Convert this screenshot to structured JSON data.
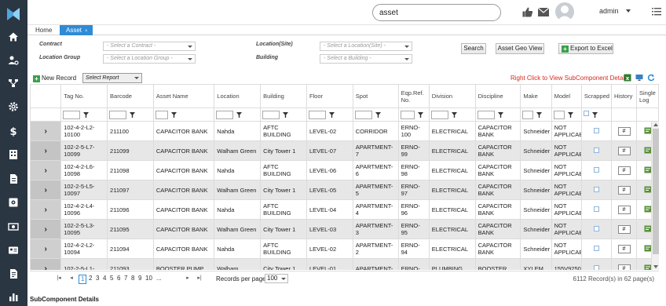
{
  "search": {
    "value": "asset"
  },
  "user": {
    "name": "admin"
  },
  "tabs": [
    {
      "label": "Home"
    },
    {
      "label": "Asset",
      "close": "×"
    }
  ],
  "filters": {
    "contract_label": "Contract",
    "contract_placeholder": "- Select a Contract -",
    "location_group_label": "Location Group",
    "location_group_placeholder": "- Select a Location Group -",
    "location_site_label": "Location(Site)",
    "location_site_placeholder": "- Select a Location(Site) -",
    "building_label": "Building",
    "building_placeholder": "- Select a Building -"
  },
  "actions": {
    "search": "Search",
    "geo_view": "Asset Geo View",
    "export": "Export to Excel"
  },
  "toolbar": {
    "new_record": "New Record",
    "report_placeholder": "Select Report",
    "hint": "Right Click to View SubComponent Details"
  },
  "columns": [
    "Tag No.",
    "Barcode",
    "Asset Name",
    "Location",
    "Building",
    "Floor",
    "Spot",
    "Eqp.Ref. No.",
    "Division",
    "Discipline",
    "Make",
    "Model",
    "Scrapped",
    "History",
    "Single Log"
  ],
  "rows": [
    {
      "tag": "102-4-2-L2-10100",
      "barcode": "211100",
      "name": "CAPACITOR BANK",
      "location": "Nahda",
      "building": "AFTC BUILDING",
      "floor": "LEVEL-02",
      "spot": "CORRIDOR",
      "eqp": "ERNO-100",
      "division": "ELECTRICAL",
      "discipline": "CAPACITOR BANK",
      "make": "Schneider",
      "model": "NOT APPLICAB",
      "history": "#"
    },
    {
      "tag": "102-2-5-L7-10099",
      "barcode": "211099",
      "name": "CAPACITOR BANK",
      "location": "Walham Green",
      "building": "City Tower 1",
      "floor": "LEVEL-07",
      "spot": "APARTMENT-7",
      "eqp": "ERNO-99",
      "division": "ELECTRICAL",
      "discipline": "CAPACITOR BANK",
      "make": "Schneider",
      "model": "NOT APPLICAB",
      "history": "#"
    },
    {
      "tag": "102-4-2-L6-10098",
      "barcode": "211098",
      "name": "CAPACITOR BANK",
      "location": "Nahda",
      "building": "AFTC BUILDING",
      "floor": "LEVEL-06",
      "spot": "APARTMENT-6",
      "eqp": "ERNO-98",
      "division": "ELECTRICAL",
      "discipline": "CAPACITOR BANK",
      "make": "Schneider",
      "model": "NOT APPLICAB",
      "history": "#"
    },
    {
      "tag": "102-2-5-L5-10097",
      "barcode": "211097",
      "name": "CAPACITOR BANK",
      "location": "Walham Green",
      "building": "City Tower 1",
      "floor": "LEVEL-05",
      "spot": "APARTMENT-5",
      "eqp": "ERNO-97",
      "division": "ELECTRICAL",
      "discipline": "CAPACITOR BANK",
      "make": "Schneider",
      "model": "NOT APPLICAB",
      "history": "#"
    },
    {
      "tag": "102-4-2-L4-10096",
      "barcode": "211096",
      "name": "CAPACITOR BANK",
      "location": "Nahda",
      "building": "AFTC BUILDING",
      "floor": "LEVEL-04",
      "spot": "APARTMENT-4",
      "eqp": "ERNO-96",
      "division": "ELECTRICAL",
      "discipline": "CAPACITOR BANK",
      "make": "Schneider",
      "model": "NOT APPLICAB",
      "history": "#"
    },
    {
      "tag": "102-2-5-L3-10095",
      "barcode": "211095",
      "name": "CAPACITOR BANK",
      "location": "Walham Green",
      "building": "City Tower 1",
      "floor": "LEVEL-03",
      "spot": "APARTMENT-3",
      "eqp": "ERNO-95",
      "division": "ELECTRICAL",
      "discipline": "CAPACITOR BANK",
      "make": "Schneider",
      "model": "NOT APPLICAB",
      "history": "#"
    },
    {
      "tag": "102-4-2-L2-10094",
      "barcode": "211094",
      "name": "CAPACITOR BANK",
      "location": "Nahda",
      "building": "AFTC BUILDING",
      "floor": "LEVEL-02",
      "spot": "APARTMENT-2",
      "eqp": "ERNO-94",
      "division": "ELECTRICAL",
      "discipline": "CAPACITOR BANK",
      "make": "Schneider",
      "model": "NOT APPLICAB",
      "history": "#"
    },
    {
      "tag": "102-2-5-L1-",
      "barcode": "211093",
      "name": "BOOSTER PUMP",
      "location": "Walham",
      "building": "City Tower 1",
      "floor": "LEVEL-01",
      "spot": "APARTMENT-",
      "eqp": "ERNO-",
      "division": "PLUMBING",
      "discipline": "BOOSTER",
      "make": "XYLEM",
      "model": "155V9250",
      "history": "#"
    }
  ],
  "pager": {
    "pages": [
      "1",
      "2",
      "3",
      "4",
      "5",
      "6",
      "7",
      "8",
      "9",
      "10",
      "..."
    ],
    "current_page": "1",
    "per_page_label": "Records per page",
    "per_page": "100",
    "info": "6112 Record(s) in 62 page(s)"
  },
  "subcomponent_title": "SubComponent Details",
  "colors": {
    "sidebar": "#2b3643",
    "tab_active": "#2e8bd6",
    "hint": "#d9291c"
  }
}
